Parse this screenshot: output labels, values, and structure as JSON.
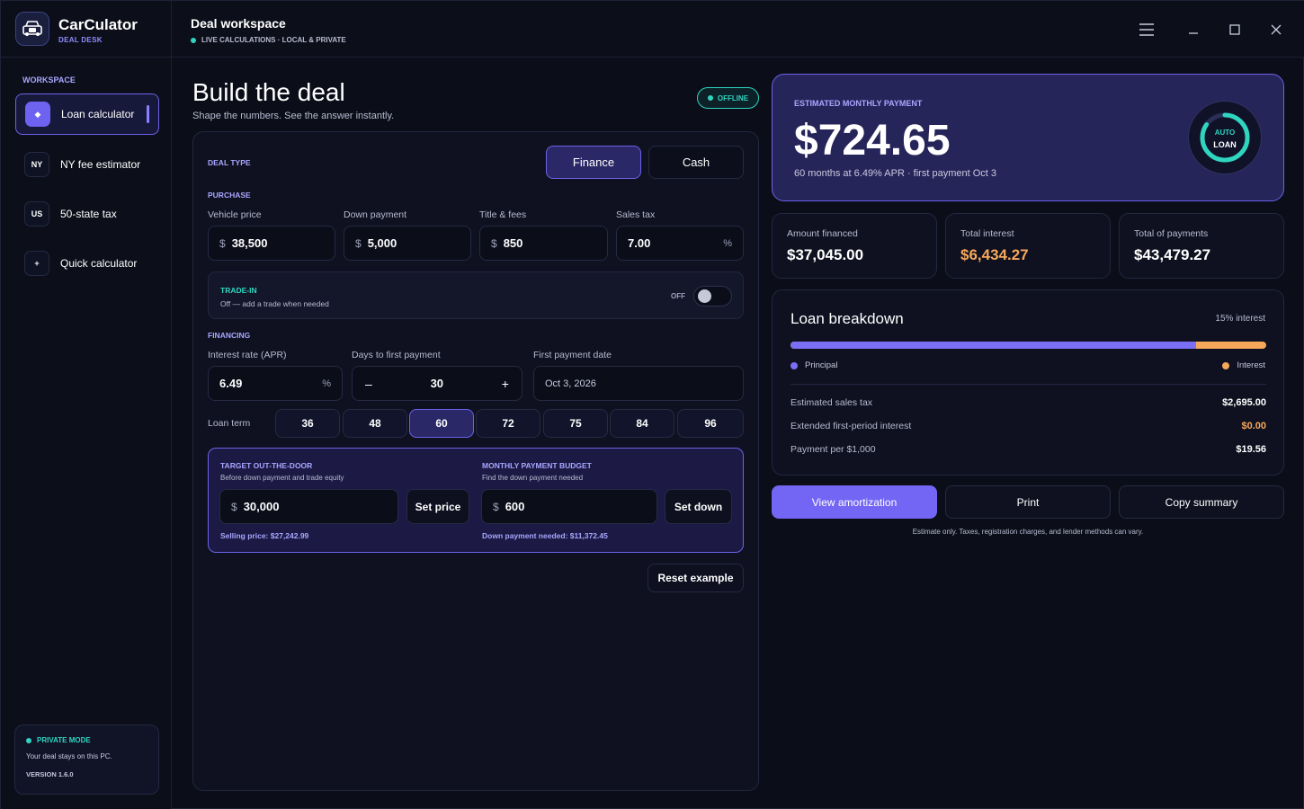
{
  "app": {
    "name": "CarCulator",
    "subtitle": "DEAL DESK"
  },
  "header": {
    "title": "Deal workspace",
    "status": "LIVE CALCULATIONS · LOCAL & PRIVATE"
  },
  "window": {
    "menu_icon": "hamburger-icon",
    "minimize_icon": "minimize-icon",
    "maximize_icon": "maximize-icon",
    "close_icon": "close-icon"
  },
  "sidebar": {
    "heading": "WORKSPACE",
    "items": [
      {
        "badge": "◆",
        "label": "Loan calculator",
        "active": true
      },
      {
        "badge": "NY",
        "label": "NY fee estimator"
      },
      {
        "badge": "US",
        "label": "50-state tax"
      },
      {
        "badge": "+",
        "label": "Quick calculator"
      }
    ],
    "private": {
      "title": "PRIVATE MODE",
      "text": "Your deal stays on this PC.",
      "version": "VERSION 1.6.0"
    }
  },
  "main": {
    "title": "Build the deal",
    "subtitle": "Shape the numbers. See the answer instantly.",
    "status_badge": "OFFLINE",
    "deal_type": {
      "label": "DEAL TYPE",
      "options": [
        "Finance",
        "Cash"
      ],
      "selected": "Finance"
    },
    "purchase": {
      "label": "PURCHASE",
      "vehicle_price": {
        "label": "Vehicle price",
        "prefix": "$",
        "value": "38,500"
      },
      "down_payment": {
        "label": "Down payment",
        "prefix": "$",
        "value": "5,000"
      },
      "title_fees": {
        "label": "Title & fees",
        "prefix": "$",
        "value": "850"
      },
      "sales_tax": {
        "label": "Sales tax",
        "value": "7.00",
        "suffix": "%"
      }
    },
    "trade_in": {
      "title": "TRADE-IN",
      "subtitle": "Off — add a trade when needed",
      "state": "OFF"
    },
    "financing": {
      "label": "FINANCING",
      "apr": {
        "label": "Interest rate (APR)",
        "value": "6.49",
        "suffix": "%"
      },
      "days": {
        "label": "Days to first payment",
        "value": "30",
        "minus": "–",
        "plus": "+"
      },
      "first_date": {
        "label": "First payment date",
        "value": "Oct 3, 2026"
      },
      "term_label": "Loan term",
      "terms": [
        "36",
        "48",
        "60",
        "72",
        "75",
        "84",
        "96"
      ],
      "selected_term": "60"
    },
    "target": {
      "otd_title": "TARGET OUT-THE-DOOR",
      "otd_sub": "Before down payment and trade equity",
      "otd_prefix": "$",
      "otd_value": "30,000",
      "otd_button": "Set price",
      "otd_note": "Selling price: $27,242.99",
      "budget_title": "MONTHLY PAYMENT BUDGET",
      "budget_sub": "Find the down payment needed",
      "budget_prefix": "$",
      "budget_value": "600",
      "budget_button": "Set down",
      "budget_note": "Down payment needed: $11,372.45"
    },
    "reset_label": "Reset example"
  },
  "results": {
    "hero": {
      "label": "ESTIMATED MONTHLY PAYMENT",
      "amount": "$724.65",
      "sub": "60 months at 6.49% APR · first payment Oct 3",
      "ring_top": "AUTO",
      "ring_bottom": "LOAN"
    },
    "stats": [
      {
        "label": "Amount financed",
        "value": "$37,045.00"
      },
      {
        "label": "Total interest",
        "value": "$6,434.27"
      },
      {
        "label": "Total of payments",
        "value": "$43,479.27"
      }
    ],
    "breakdown": {
      "title": "Loan breakdown",
      "interest_pct_label": "15% interest",
      "principal_fraction": 0.852,
      "legend_principal": "Principal",
      "legend_interest": "Interest",
      "rows": [
        {
          "label": "Estimated sales tax",
          "value": "$2,695.00"
        },
        {
          "label": "Extended first-period interest",
          "value": "$0.00"
        },
        {
          "label": "Payment per $1,000",
          "value": "$19.56"
        }
      ]
    },
    "actions": {
      "amortization": "View amortization",
      "print": "Print",
      "copy": "Copy summary"
    },
    "disclaimer": "Estimate only. Taxes, registration charges, and lender methods can vary."
  },
  "colors": {
    "accent": "#7366f5",
    "teal": "#2fd5bf",
    "orange": "#f5a85a",
    "background": "#0b0d18"
  }
}
